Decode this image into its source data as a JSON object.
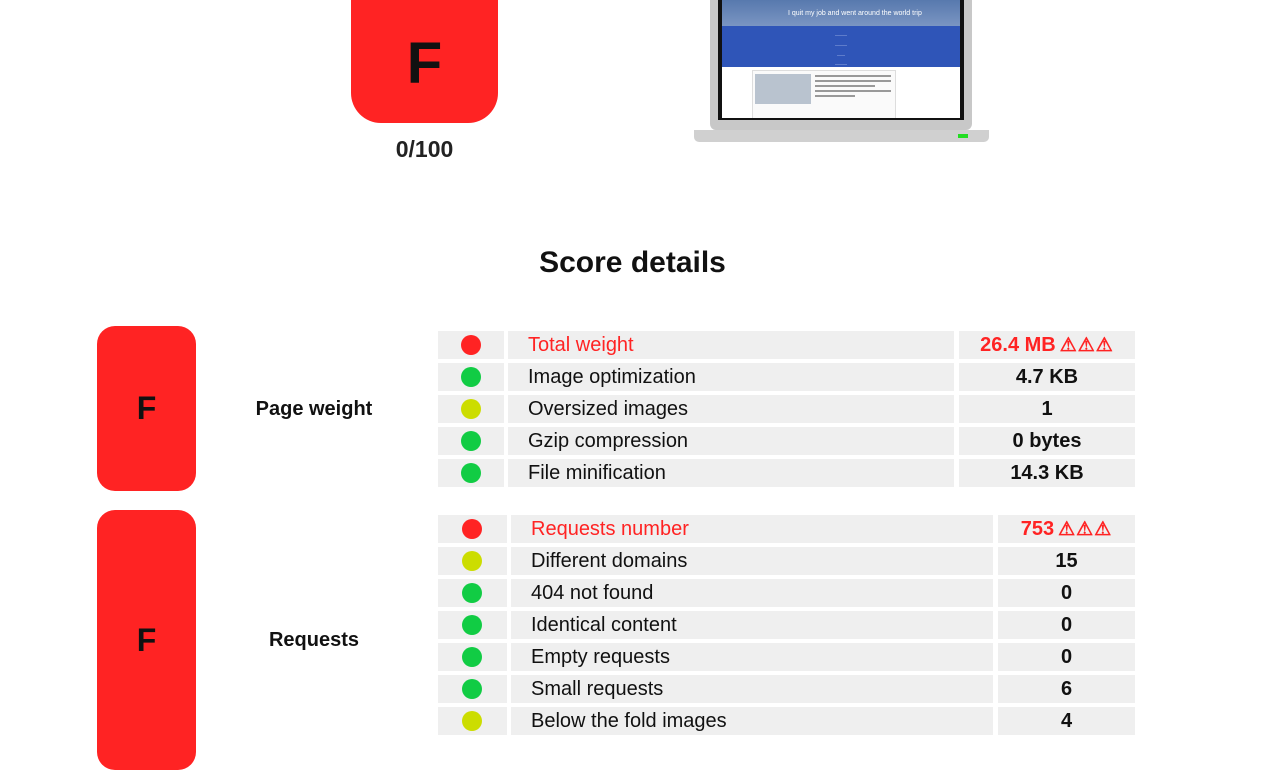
{
  "summary": {
    "grade": "F",
    "score": "0/100"
  },
  "preview": {
    "site_subtitle": "I quit my job and went around the world trip",
    "colors": {
      "header": "#2f55b8",
      "screen_frame": "#111111",
      "led": "#22dd22"
    }
  },
  "section_title": "Score details",
  "colors": {
    "red": "#ff2323",
    "green": "#11cc44",
    "yellow": "#ccdd00",
    "row_bg": "#efefef"
  },
  "categories": [
    {
      "grade": "F",
      "label": "Page weight",
      "rows": [
        {
          "name": "Total weight",
          "value": "26.4 MB",
          "status": "red",
          "warning": "⚠⚠⚠"
        },
        {
          "name": "Image optimization",
          "value": "4.7 KB",
          "status": "green"
        },
        {
          "name": "Oversized images",
          "value": "1",
          "status": "yellow"
        },
        {
          "name": "Gzip compression",
          "value": "0 bytes",
          "status": "green"
        },
        {
          "name": "File minification",
          "value": "14.3 KB",
          "status": "green"
        }
      ]
    },
    {
      "grade": "F",
      "label": "Requests",
      "rows": [
        {
          "name": "Requests number",
          "value": "753",
          "status": "red",
          "warning": "⚠⚠⚠"
        },
        {
          "name": "Different domains",
          "value": "15",
          "status": "yellow"
        },
        {
          "name": "404 not found",
          "value": "0",
          "status": "green"
        },
        {
          "name": "Identical content",
          "value": "0",
          "status": "green"
        },
        {
          "name": "Empty requests",
          "value": "0",
          "status": "green"
        },
        {
          "name": "Small requests",
          "value": "6",
          "status": "green"
        },
        {
          "name": "Below the fold images",
          "value": "4",
          "status": "yellow"
        }
      ]
    }
  ]
}
